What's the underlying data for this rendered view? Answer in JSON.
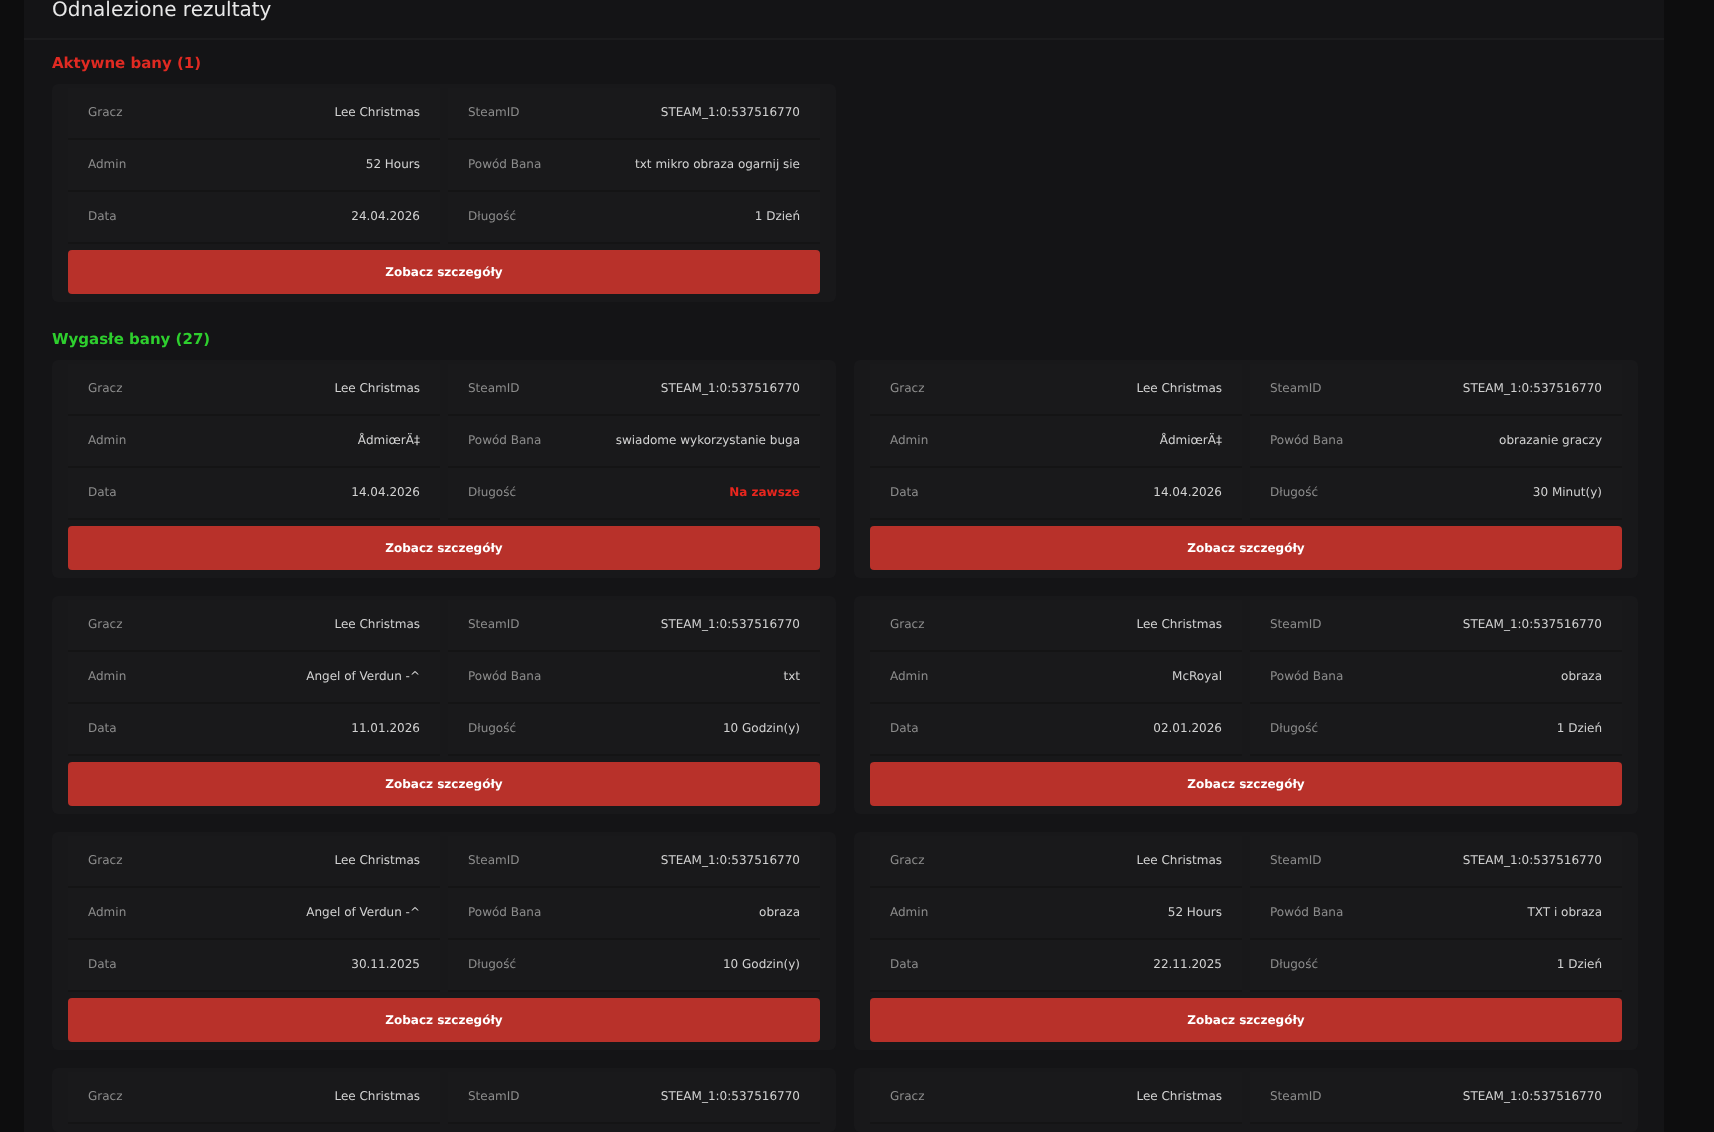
{
  "title": "Odnalezione rezultaty",
  "sections": [
    {
      "title": "Aktywne bany (1)",
      "kind": "active",
      "cards": [
        {
          "fields": [
            {
              "label": "Gracz",
              "value": "Lee Christmas",
              "emphasis": false
            },
            {
              "label": "SteamID",
              "value": "STEAM_1:0:537516770",
              "emphasis": false
            },
            {
              "label": "Admin",
              "value": "52 Hours",
              "emphasis": false
            },
            {
              "label": "Powód Bana",
              "value": "txt mikro obraza ogarnij sie",
              "emphasis": false
            },
            {
              "label": "Data",
              "value": "24.04.2026",
              "emphasis": false
            },
            {
              "label": "Długość",
              "value": "1 Dzień",
              "emphasis": false
            }
          ],
          "button": "Zobacz szczegóły"
        }
      ]
    },
    {
      "title": "Wygasłe bany (27)",
      "kind": "expired",
      "cards": [
        {
          "fields": [
            {
              "label": "Gracz",
              "value": "Lee Christmas",
              "emphasis": false
            },
            {
              "label": "SteamID",
              "value": "STEAM_1:0:537516770",
              "emphasis": false
            },
            {
              "label": "Admin",
              "value": "ÅdmiœrÄ‡",
              "emphasis": false
            },
            {
              "label": "Powód Bana",
              "value": "swiadome wykorzystanie buga",
              "emphasis": false
            },
            {
              "label": "Data",
              "value": "14.04.2026",
              "emphasis": false
            },
            {
              "label": "Długość",
              "value": "Na zawsze",
              "emphasis": true
            }
          ],
          "button": "Zobacz szczegóły"
        },
        {
          "fields": [
            {
              "label": "Gracz",
              "value": "Lee Christmas",
              "emphasis": false
            },
            {
              "label": "SteamID",
              "value": "STEAM_1:0:537516770",
              "emphasis": false
            },
            {
              "label": "Admin",
              "value": "ÅdmiœrÄ‡",
              "emphasis": false
            },
            {
              "label": "Powód Bana",
              "value": "obrazanie graczy",
              "emphasis": false
            },
            {
              "label": "Data",
              "value": "14.04.2026",
              "emphasis": false
            },
            {
              "label": "Długość",
              "value": "30 Minut(y)",
              "emphasis": false
            }
          ],
          "button": "Zobacz szczegóły"
        },
        {
          "fields": [
            {
              "label": "Gracz",
              "value": "Lee Christmas",
              "emphasis": false
            },
            {
              "label": "SteamID",
              "value": "STEAM_1:0:537516770",
              "emphasis": false
            },
            {
              "label": "Admin",
              "value": "Angel of Verdun -^",
              "emphasis": false
            },
            {
              "label": "Powód Bana",
              "value": "txt",
              "emphasis": false
            },
            {
              "label": "Data",
              "value": "11.01.2026",
              "emphasis": false
            },
            {
              "label": "Długość",
              "value": "10 Godzin(y)",
              "emphasis": false
            }
          ],
          "button": "Zobacz szczegóły"
        },
        {
          "fields": [
            {
              "label": "Gracz",
              "value": "Lee Christmas",
              "emphasis": false
            },
            {
              "label": "SteamID",
              "value": "STEAM_1:0:537516770",
              "emphasis": false
            },
            {
              "label": "Admin",
              "value": "McRoyal",
              "emphasis": false
            },
            {
              "label": "Powód Bana",
              "value": "obraza",
              "emphasis": false
            },
            {
              "label": "Data",
              "value": "02.01.2026",
              "emphasis": false
            },
            {
              "label": "Długość",
              "value": "1 Dzień",
              "emphasis": false
            }
          ],
          "button": "Zobacz szczegóły"
        },
        {
          "fields": [
            {
              "label": "Gracz",
              "value": "Lee Christmas",
              "emphasis": false
            },
            {
              "label": "SteamID",
              "value": "STEAM_1:0:537516770",
              "emphasis": false
            },
            {
              "label": "Admin",
              "value": "Angel of Verdun -^",
              "emphasis": false
            },
            {
              "label": "Powód Bana",
              "value": "obraza",
              "emphasis": false
            },
            {
              "label": "Data",
              "value": "30.11.2025",
              "emphasis": false
            },
            {
              "label": "Długość",
              "value": "10 Godzin(y)",
              "emphasis": false
            }
          ],
          "button": "Zobacz szczegóły"
        },
        {
          "fields": [
            {
              "label": "Gracz",
              "value": "Lee Christmas",
              "emphasis": false
            },
            {
              "label": "SteamID",
              "value": "STEAM_1:0:537516770",
              "emphasis": false
            },
            {
              "label": "Admin",
              "value": "52 Hours",
              "emphasis": false
            },
            {
              "label": "Powód Bana",
              "value": "TXT i obraza",
              "emphasis": false
            },
            {
              "label": "Data",
              "value": "22.11.2025",
              "emphasis": false
            },
            {
              "label": "Długość",
              "value": "1 Dzień",
              "emphasis": false
            }
          ],
          "button": "Zobacz szczegóły"
        },
        {
          "fields": [
            {
              "label": "Gracz",
              "value": "Lee Christmas",
              "emphasis": false
            },
            {
              "label": "SteamID",
              "value": "STEAM_1:0:537516770",
              "emphasis": false
            }
          ]
        },
        {
          "fields": [
            {
              "label": "Gracz",
              "value": "Lee Christmas",
              "emphasis": false
            },
            {
              "label": "SteamID",
              "value": "STEAM_1:0:537516770",
              "emphasis": false
            }
          ]
        }
      ]
    }
  ]
}
